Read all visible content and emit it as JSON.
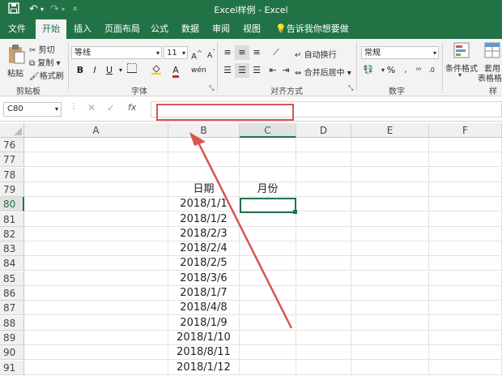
{
  "window": {
    "title": "Excel样例 - Excel"
  },
  "tabs": [
    "文件",
    "开始",
    "插入",
    "页面布局",
    "公式",
    "数据",
    "审阅",
    "视图"
  ],
  "tell_me": "告诉我你想要做什么",
  "clipboard": {
    "paste": "粘贴",
    "cut": "剪切",
    "copy": "复制",
    "format_painter": "格式刷",
    "group": "剪贴板"
  },
  "font": {
    "name": "等线",
    "size": "11",
    "group": "字体",
    "bold": "B",
    "italic": "I",
    "underline": "U",
    "font_color": "A",
    "font_color_hex": "#e02020",
    "fill_color_hex": "#ffd200"
  },
  "alignment": {
    "wrap": "自动换行",
    "merge": "合并后居中",
    "group": "对齐方式"
  },
  "number": {
    "format": "常规",
    "percent": "%",
    "group": "数字"
  },
  "styles": {
    "conditional": "条件格式",
    "table_format_1": "套用",
    "table_format_2": "表格格式",
    "group": "样式"
  },
  "formula_bar": {
    "name_box": "C80",
    "cancel": "✕",
    "enter": "✓",
    "fx": "fx",
    "value": ""
  },
  "columns": [
    "A",
    "B",
    "C",
    "D",
    "E",
    "F"
  ],
  "selected_column": "C",
  "rows": [
    {
      "n": "76",
      "b": "",
      "c": ""
    },
    {
      "n": "77",
      "b": "",
      "c": ""
    },
    {
      "n": "78",
      "b": "",
      "c": ""
    },
    {
      "n": "79",
      "b": "日期",
      "c": "月份"
    },
    {
      "n": "80",
      "b": "2018/1/1",
      "c": ""
    },
    {
      "n": "81",
      "b": "2018/1/2",
      "c": ""
    },
    {
      "n": "82",
      "b": "2018/2/3",
      "c": ""
    },
    {
      "n": "83",
      "b": "2018/2/4",
      "c": ""
    },
    {
      "n": "84",
      "b": "2018/2/5",
      "c": ""
    },
    {
      "n": "85",
      "b": "2018/3/6",
      "c": ""
    },
    {
      "n": "86",
      "b": "2018/1/7",
      "c": ""
    },
    {
      "n": "87",
      "b": "2018/4/8",
      "c": ""
    },
    {
      "n": "88",
      "b": "2018/1/9",
      "c": ""
    },
    {
      "n": "89",
      "b": "2018/1/10",
      "c": ""
    },
    {
      "n": "90",
      "b": "2018/8/11",
      "c": ""
    },
    {
      "n": "91",
      "b": "2018/1/12",
      "c": ""
    }
  ],
  "selected_row": "80",
  "annotation_color": "#d9534f"
}
